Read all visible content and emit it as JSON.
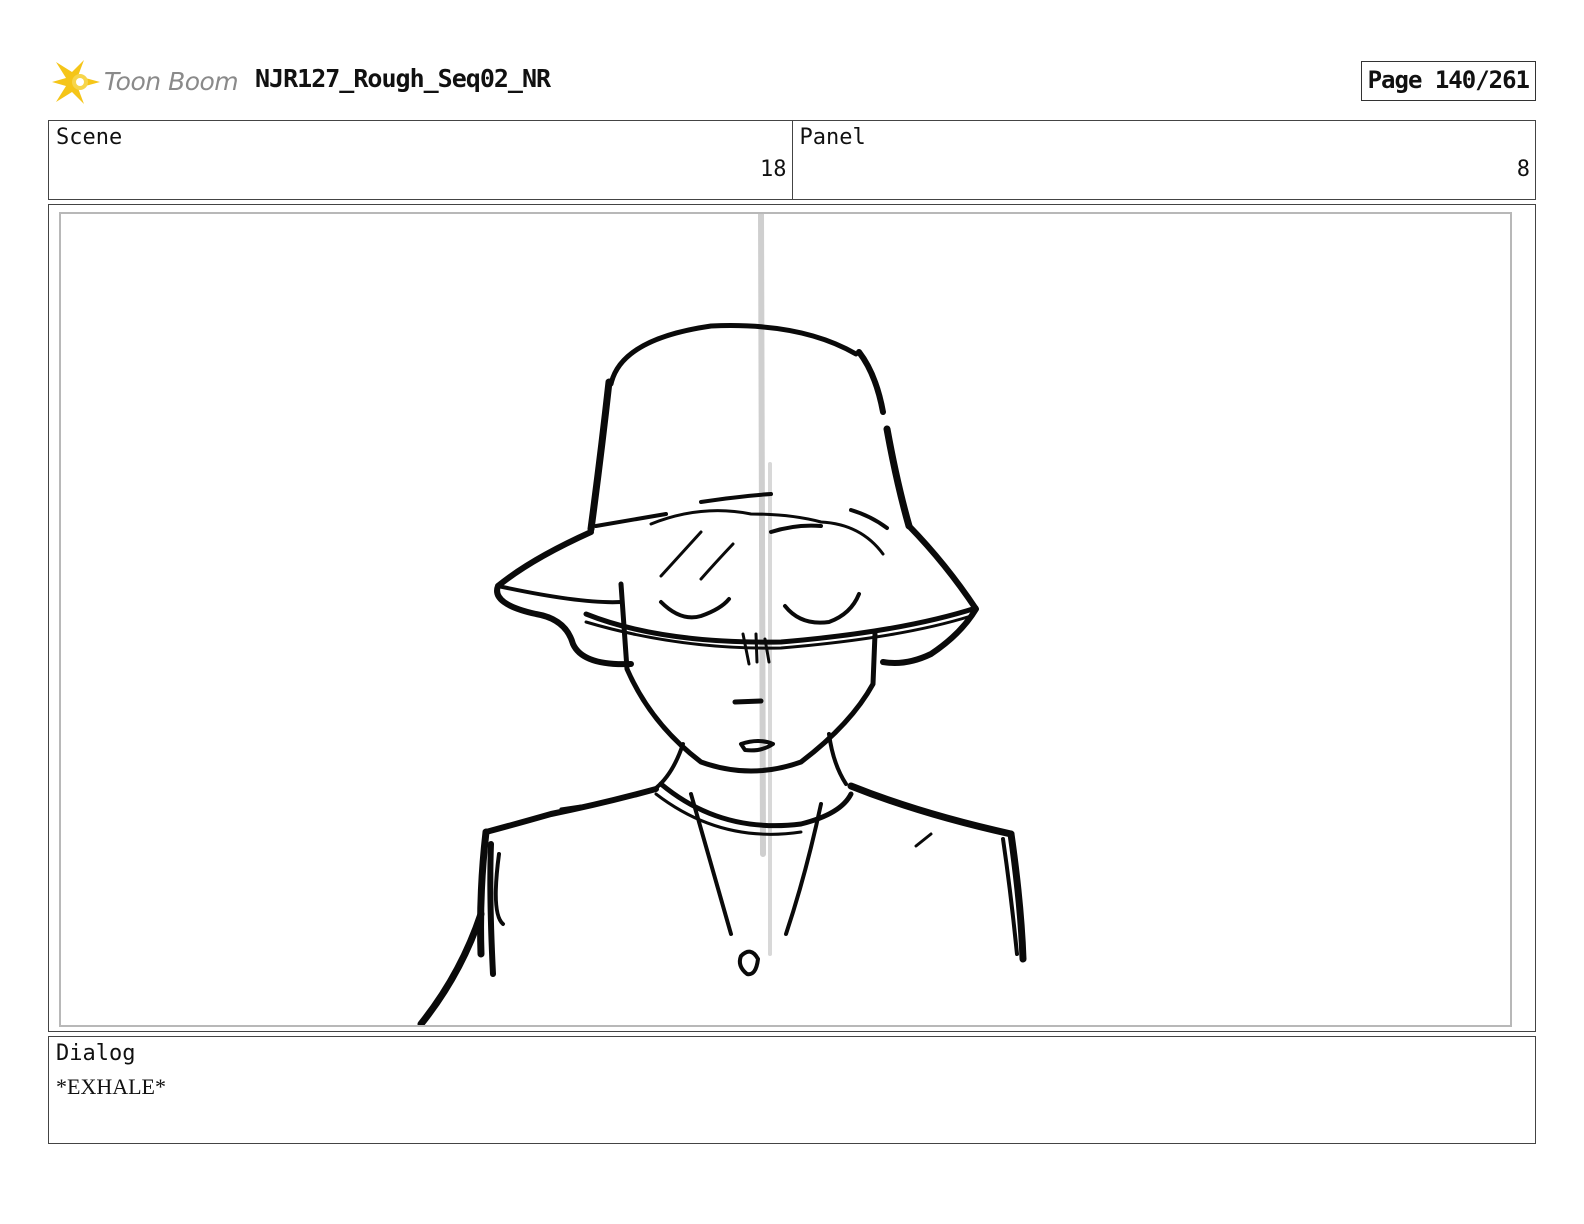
{
  "header": {
    "logo_text": "Toon Boom",
    "project_title": "NJR127_Rough_Seq02_NR",
    "page_label": "Page 140/261"
  },
  "info": {
    "scene_label": "Scene",
    "scene_value": "18",
    "panel_label": "Panel",
    "panel_value": "8"
  },
  "panel": {
    "sketch_icon": "character-bucket-hat-sketch"
  },
  "dialog": {
    "label": "Dialog",
    "text": "*EXHALE*"
  },
  "colors": {
    "logo_accent": "#f5c518",
    "logo_text": "#8a8a8a",
    "border": "#444444",
    "panel_inner_border": "#b8b8b8"
  }
}
